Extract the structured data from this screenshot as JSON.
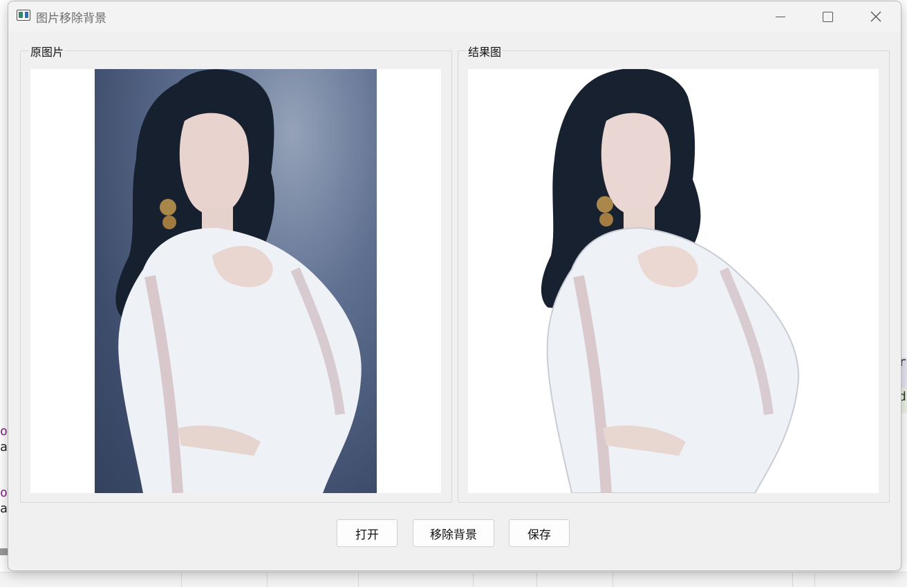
{
  "window": {
    "title": "图片移除背景",
    "controls": {
      "minimize": "minimize",
      "maximize": "maximize",
      "close": "close"
    }
  },
  "panels": {
    "original": {
      "label": "原图片",
      "image_alt": "woman in white lace blouse, grey-blue backdrop"
    },
    "result": {
      "label": "结果图",
      "image_alt": "woman in white lace blouse, background removed"
    }
  },
  "buttons": {
    "open": "打开",
    "remove_background": "移除背景",
    "save": "保存"
  },
  "background_fragments": {
    "left": [
      "ol",
      "ag",
      "ol",
      "ag"
    ],
    "right": [
      "re",
      "d"
    ]
  },
  "colors": {
    "window_bg": "#f0f0f0",
    "canvas_bg": "#ffffff",
    "photo_backdrop": "#4a5a78",
    "hair": "#16202e",
    "blouse": "#eef1f6"
  }
}
